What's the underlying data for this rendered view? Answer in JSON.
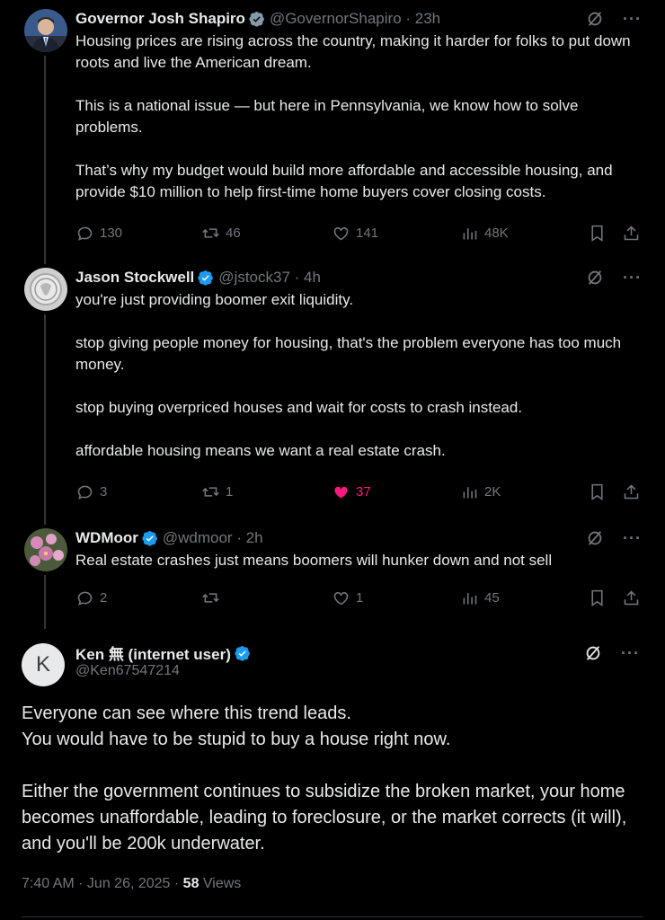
{
  "posts": [
    {
      "name": "Governor Josh Shapiro",
      "handle": "@GovernorShapiro",
      "time": "23h",
      "paragraphs": [
        "Housing prices are rising across the country, making it harder for folks to put down roots and live the American dream.",
        "This is a national issue — but here in Pennsylvania, we know how to solve problems.",
        "That’s why my budget would build more affordable and accessible housing, and provide $10 million to help first-time home buyers cover closing costs."
      ],
      "replies": "130",
      "reposts": "46",
      "likes": "141",
      "views": "48K"
    },
    {
      "name": "Jason Stockwell",
      "handle": "@jstock37",
      "time": "4h",
      "paragraphs": [
        "you're just providing boomer exit liquidity.",
        "stop giving people money for housing, that's the problem everyone has too much money.",
        "stop buying overpriced houses and wait for costs to crash instead.",
        "affordable housing means we want a real estate crash."
      ],
      "replies": "3",
      "reposts": "1",
      "likes": "37",
      "views": "2K"
    },
    {
      "name": "WDMoor",
      "handle": "@wdmoor",
      "time": "2h",
      "paragraphs": [
        "Real estate crashes just means boomers will hunker down and not sell"
      ],
      "replies": "2",
      "reposts": "",
      "likes": "1",
      "views": "45"
    }
  ],
  "focus": {
    "avatar_letter": "K",
    "name": "Ken 無 (internet user)",
    "handle": "@Ken67547214",
    "paragraph1_line1": "Everyone can see where this trend leads.",
    "paragraph1_line2": "You would have to be stupid to buy a house right now.",
    "paragraph2": "Either the government continues to subsidize the broken market, your home becomes unaffordable, leading to foreclosure, or the market corrects (it will), and you'll be 200k underwater.",
    "timestamp": "7:40 AM · Jun 26, 2025 · ",
    "views_count": "58",
    "views_label": " Views"
  },
  "colors": {
    "background": "#000000",
    "text": "#e7e9ea",
    "muted": "#71767b",
    "verified": "#1d9bf0",
    "like": "#f91880"
  }
}
